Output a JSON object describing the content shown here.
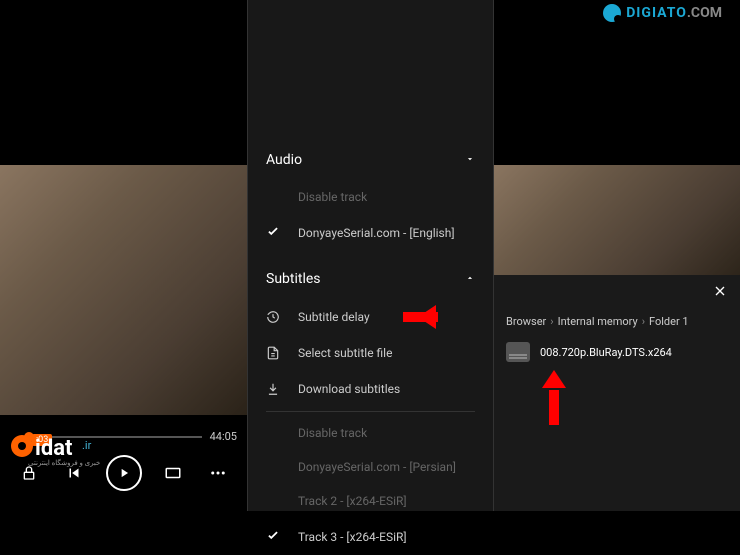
{
  "watermarks": {
    "digiato_part1": "DIGIATO",
    "digiato_part2": ".COM",
    "gidat": "idat.ir"
  },
  "player": {
    "current_time": ":03",
    "total_time": "44:05"
  },
  "menu": {
    "audio": {
      "header": "Audio",
      "disable_track": "Disable track",
      "track1": "DonyayeSerial.com - [English]"
    },
    "subtitles": {
      "header": "Subtitles",
      "delay": "Subtitle delay",
      "select_file": "Select subtitle file",
      "download": "Download subtitles",
      "disable_track": "Disable track",
      "track1": "DonyayeSerial.com - [Persian]",
      "track2": "Track 2 - [x264-ESiR]",
      "track3": "Track 3 - [x264-ESiR]"
    }
  },
  "browser": {
    "crumb1": "Browser",
    "crumb2": "Internal memory",
    "crumb3": "Folder 1",
    "file1": "008.720p.BluRay.DTS.x264"
  }
}
